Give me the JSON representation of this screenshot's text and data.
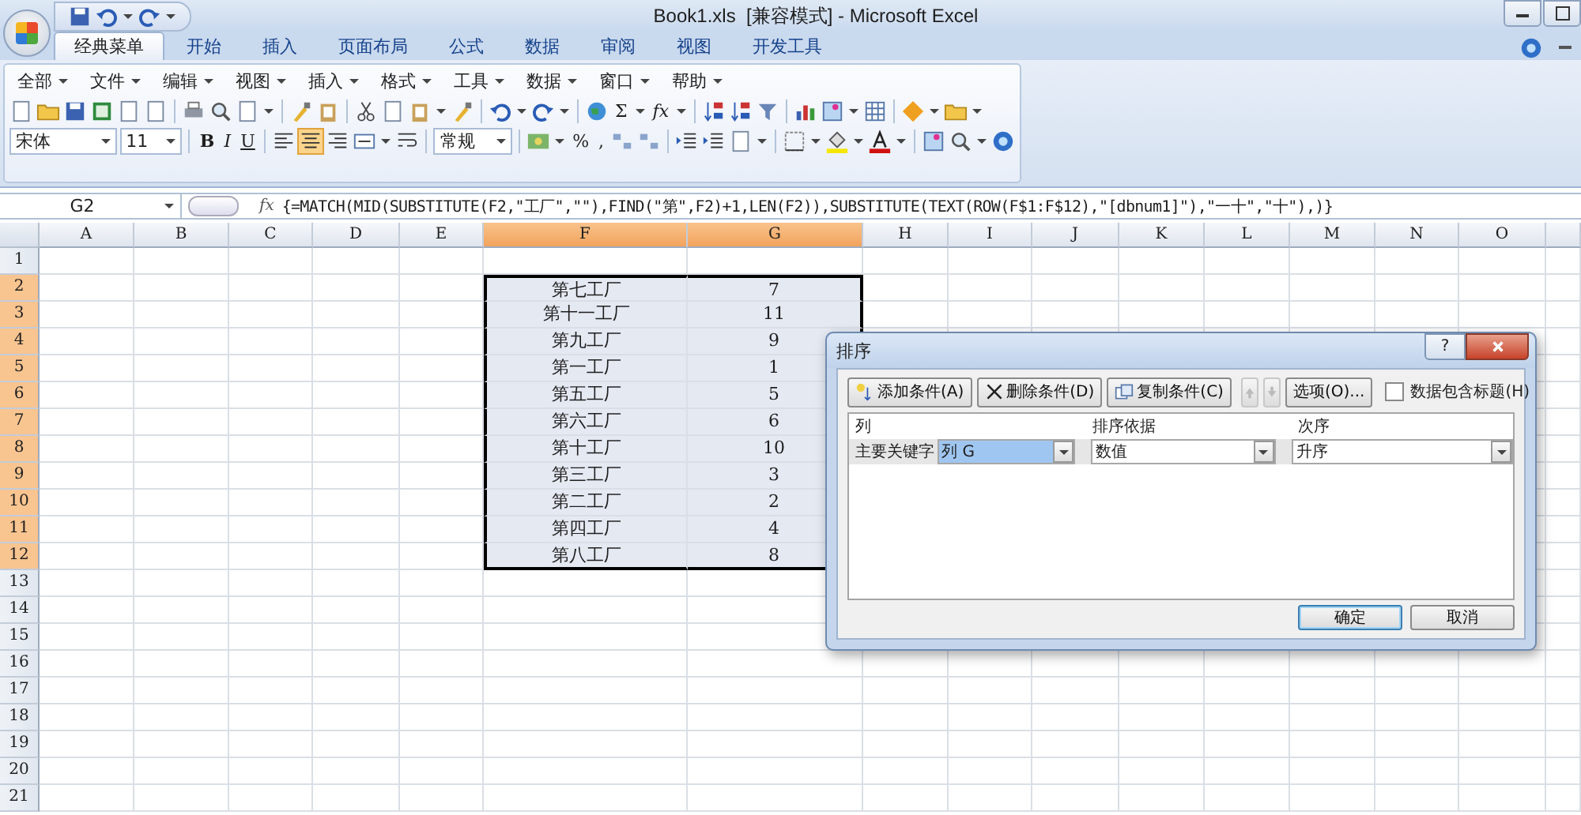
{
  "window": {
    "title": "Book1.xls  [兼容模式] - Microsoft Excel"
  },
  "tabs": [
    {
      "label": "经典菜单",
      "selected": true
    },
    {
      "label": "开始",
      "selected": false
    },
    {
      "label": "插入",
      "selected": false
    },
    {
      "label": "页面布局",
      "selected": false
    },
    {
      "label": "公式",
      "selected": false
    },
    {
      "label": "数据",
      "selected": false
    },
    {
      "label": "审阅",
      "selected": false
    },
    {
      "label": "视图",
      "selected": false
    },
    {
      "label": "开发工具",
      "selected": false
    }
  ],
  "menus": [
    {
      "label": "全部"
    },
    {
      "label": "文件"
    },
    {
      "label": "编辑"
    },
    {
      "label": "视图"
    },
    {
      "label": "插入"
    },
    {
      "label": "格式"
    },
    {
      "label": "工具"
    },
    {
      "label": "数据"
    },
    {
      "label": "窗口"
    },
    {
      "label": "帮助"
    }
  ],
  "toolbar": {
    "sum": "Σ",
    "function": "fx",
    "font": "宋体",
    "size": "11",
    "bold": "B",
    "italic": "I",
    "underline": "U",
    "align_center": true,
    "number_format": "常规",
    "percent": "%",
    "comma": ","
  },
  "formula_bar": {
    "name_box": "G2",
    "fx": "fx",
    "formula": "{=MATCH(MID(SUBSTITUTE(F2,\"工厂\",\"\"),FIND(\"第\",F2)+1,LEN(F2)),SUBSTITUTE(TEXT(ROW(F$1:F$12),\"[dbnum1]\"),\"一十\",\"十\"),)}"
  },
  "sheet": {
    "columns": [
      {
        "label": "A",
        "selected": false
      },
      {
        "label": "B",
        "selected": false
      },
      {
        "label": "C",
        "selected": false
      },
      {
        "label": "D",
        "selected": false
      },
      {
        "label": "E",
        "selected": false
      },
      {
        "label": "F",
        "selected": true
      },
      {
        "label": "G",
        "selected": true
      },
      {
        "label": "H",
        "selected": false
      },
      {
        "label": "I",
        "selected": false
      },
      {
        "label": "J",
        "selected": false
      },
      {
        "label": "K",
        "selected": false
      },
      {
        "label": "L",
        "selected": false
      },
      {
        "label": "M",
        "selected": false
      },
      {
        "label": "N",
        "selected": false
      },
      {
        "label": "O",
        "selected": false
      }
    ],
    "rows": [
      {
        "label": "1",
        "selected": false
      },
      {
        "label": "2",
        "selected": true,
        "f": "第七工厂",
        "g": "7"
      },
      {
        "label": "3",
        "selected": true,
        "f": "第十一工厂",
        "g": "11"
      },
      {
        "label": "4",
        "selected": true,
        "f": "第九工厂",
        "g": "9"
      },
      {
        "label": "5",
        "selected": true,
        "f": "第一工厂",
        "g": "1"
      },
      {
        "label": "6",
        "selected": true,
        "f": "第五工厂",
        "g": "5"
      },
      {
        "label": "7",
        "selected": true,
        "f": "第六工厂",
        "g": "6"
      },
      {
        "label": "8",
        "selected": true,
        "f": "第十工厂",
        "g": "10"
      },
      {
        "label": "9",
        "selected": true,
        "f": "第三工厂",
        "g": "3"
      },
      {
        "label": "10",
        "selected": true,
        "f": "第二工厂",
        "g": "2"
      },
      {
        "label": "11",
        "selected": true,
        "f": "第四工厂",
        "g": "4"
      },
      {
        "label": "12",
        "selected": true,
        "f": "第八工厂",
        "g": "8"
      },
      {
        "label": "13",
        "selected": false
      },
      {
        "label": "14",
        "selected": false
      },
      {
        "label": "15",
        "selected": false
      },
      {
        "label": "16",
        "selected": false
      },
      {
        "label": "17",
        "selected": false
      },
      {
        "label": "18",
        "selected": false
      },
      {
        "label": "19",
        "selected": false
      },
      {
        "label": "20",
        "selected": false
      },
      {
        "label": "21",
        "selected": false
      }
    ]
  },
  "sort_dialog": {
    "title": "排序",
    "help": "?",
    "buttons": [
      {
        "kind": "add",
        "label": "添加条件(A)",
        "disabled": false
      },
      {
        "kind": "delete",
        "label": "删除条件(D)",
        "disabled": false
      },
      {
        "kind": "copy",
        "label": "复制条件(C)",
        "disabled": false
      },
      {
        "kind": "up",
        "disabled": true
      },
      {
        "kind": "down",
        "disabled": true
      },
      {
        "kind": "text",
        "label": "选项(O)...",
        "disabled": false
      }
    ],
    "has_headers": {
      "label": "数据包含标题(H)",
      "checked": false
    },
    "headers": [
      "列",
      "排序依据",
      "次序"
    ],
    "conditions": [
      {
        "label": "主要关键字",
        "column": "列 G",
        "sort_on": "数值",
        "order": "升序",
        "selected": true
      }
    ],
    "ok": "确定",
    "cancel": "取消"
  }
}
